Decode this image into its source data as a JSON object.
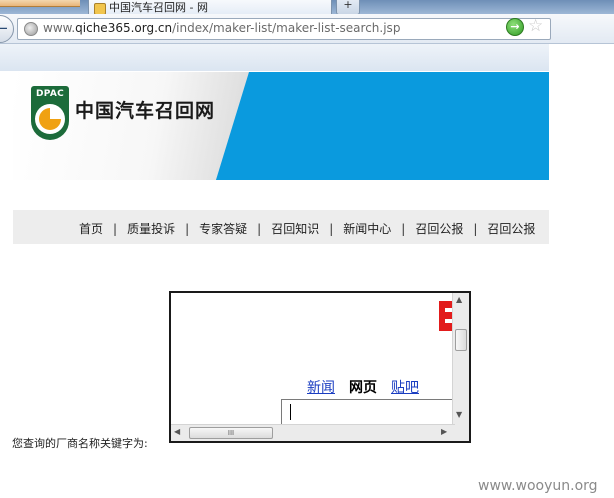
{
  "browser": {
    "tab_title": "中国汽车召回网 - 网",
    "new_tab_label": "+",
    "url_prefix": "www.",
    "url_domain": "qiche365.org.cn",
    "url_path": "/index/maker-list/maker-list-search.jsp"
  },
  "header": {
    "logo_text": "DPAC",
    "site_name": "中国汽车召回网"
  },
  "menu": {
    "items": [
      "首页",
      "质量投诉",
      "专家答疑",
      "召回知识",
      "新闻中心",
      "召回公报",
      "召回公报"
    ],
    "separator": "|"
  },
  "search": {
    "query_label": "您查询的厂商名称关键字为:"
  },
  "embedded": {
    "links": [
      "新闻",
      "网页",
      "贴吧"
    ],
    "active_link": "网页",
    "hscroll_grip": "III"
  },
  "watermark": "www.wooyun.org"
}
